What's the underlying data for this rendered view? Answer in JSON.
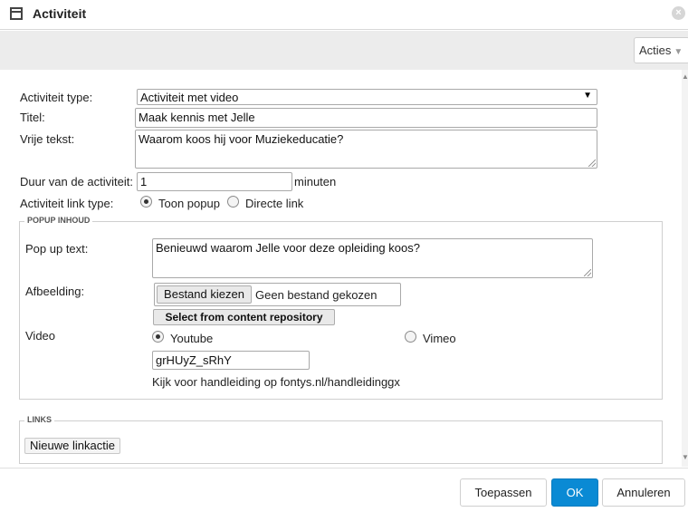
{
  "window": {
    "title": "Activiteit",
    "icon": "window-icon",
    "close_glyph": "×"
  },
  "toolbar": {
    "acties_label": "Acties",
    "acties_caret": "▼"
  },
  "form": {
    "type_label": "Activiteit type:",
    "type_value": "Activiteit met video",
    "type_arrow": "▼",
    "titel_label": "Titel:",
    "titel_value": "Maak kennis met Jelle",
    "vrije_label": "Vrije tekst:",
    "vrije_value": "Waarom koos hij voor Muziekeducatie?",
    "duur_label": "Duur van de activiteit:",
    "duur_value": "1",
    "duur_unit": "minuten",
    "linktype_label": "Activiteit link type:",
    "linktype_options": [
      {
        "label": "Toon popup",
        "checked": true
      },
      {
        "label": "Directe link",
        "checked": false
      }
    ]
  },
  "popup": {
    "legend": "POPUP INHOUD",
    "text_label": "Pop up text:",
    "text_value": "Benieuwd waarom Jelle voor deze opleiding koos?",
    "afbeelding_label": "Afbeelding:",
    "file_button": "Bestand kiezen",
    "file_status": "Geen bestand gekozen",
    "repo_button": "Select from content repository",
    "video_label": "Video",
    "video_options": [
      {
        "label": "Youtube",
        "checked": true
      },
      {
        "label": "Vimeo",
        "checked": false
      }
    ],
    "video_id": "grHUyZ_sRhY",
    "help_text": "Kijk voor handleiding op fontys.nl/handleidinggx"
  },
  "links": {
    "legend": "LINKS",
    "new_button": "Nieuwe linkactie"
  },
  "footer": {
    "apply": "Toepassen",
    "ok": "OK",
    "cancel": "Annuleren"
  },
  "colors": {
    "primary": "#0a8ad4",
    "toolbar_bg": "#ececec"
  }
}
